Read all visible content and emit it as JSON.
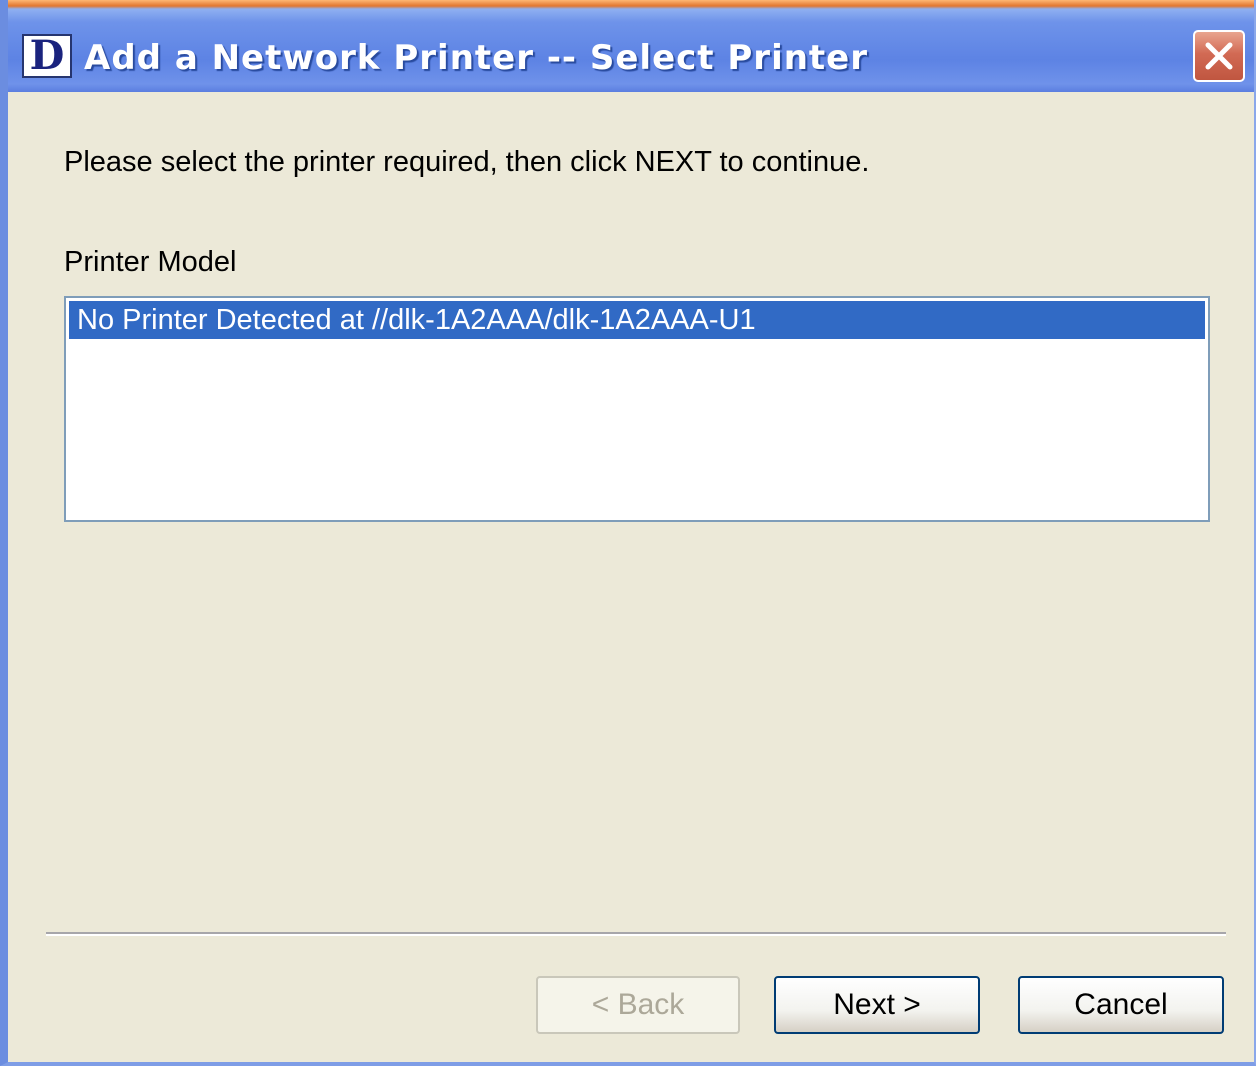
{
  "window": {
    "title": "Add a Network Printer -- Select Printer",
    "logo_letter": "D",
    "close_icon": "close-x-icon"
  },
  "main": {
    "instruction": "Please select the printer required, then click NEXT to continue.",
    "list_label": "Printer Model",
    "printers": [
      {
        "label": "No Printer Detected  at //dlk-1A2AAA/dlk-1A2AAA-U1",
        "selected": true
      }
    ]
  },
  "footer": {
    "back_label": "< Back",
    "next_label": "Next >",
    "cancel_label": "Cancel",
    "back_enabled": false
  },
  "colors": {
    "titlebar_blue": "#5d83e4",
    "selection_blue": "#316ac5",
    "dialog_face": "#ece9d8",
    "close_red": "#d26a54"
  }
}
